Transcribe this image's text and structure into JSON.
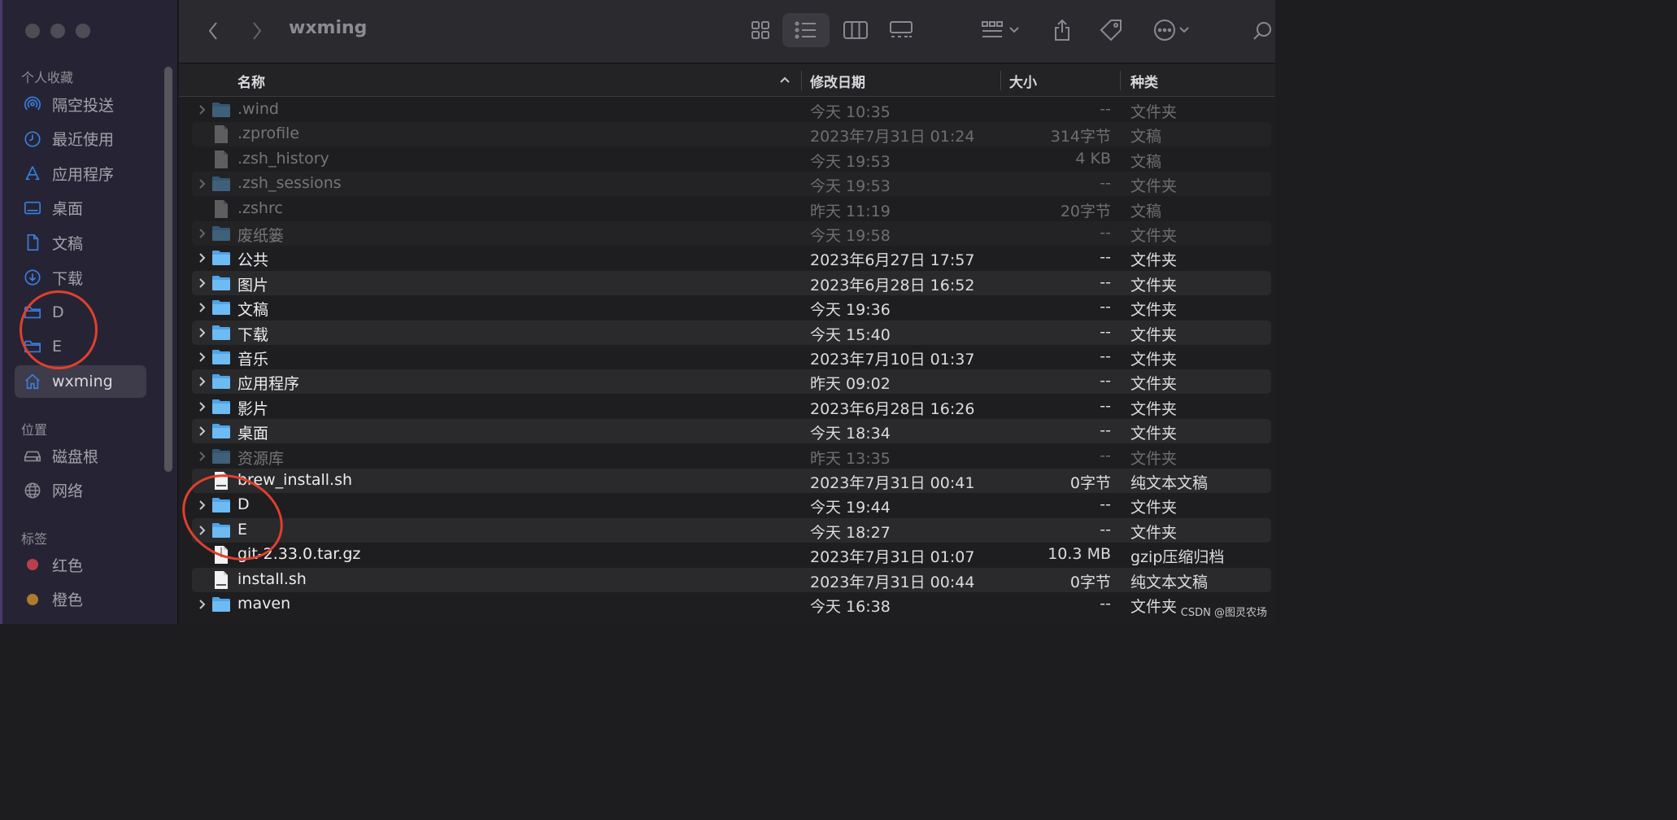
{
  "window": {
    "title": "wxming"
  },
  "sidebar": {
    "favorites_title": "个人收藏",
    "favorites": [
      {
        "label": "隔空投送",
        "icon": "airdrop-icon"
      },
      {
        "label": "最近使用",
        "icon": "clock-icon"
      },
      {
        "label": "应用程序",
        "icon": "applications-icon"
      },
      {
        "label": "桌面",
        "icon": "desktop-icon"
      },
      {
        "label": "文稿",
        "icon": "document-icon"
      },
      {
        "label": "下载",
        "icon": "download-icon"
      },
      {
        "label": "D",
        "icon": "folder-icon"
      },
      {
        "label": "E",
        "icon": "folder-icon"
      },
      {
        "label": "wxming",
        "icon": "home-icon",
        "active": true
      }
    ],
    "locations_title": "位置",
    "locations": [
      {
        "label": "磁盘根",
        "icon": "disk-icon"
      },
      {
        "label": "网络",
        "icon": "network-icon"
      }
    ],
    "tags_title": "标签",
    "tags": [
      {
        "label": "红色",
        "color": "#b8404a"
      },
      {
        "label": "橙色",
        "color": "#b07a2e"
      }
    ]
  },
  "table": {
    "columns": {
      "name": "名称",
      "date": "修改日期",
      "size": "大小",
      "kind": "种类"
    },
    "rows": [
      {
        "name": ".wind",
        "date": "今天 10:35",
        "size": "--",
        "kind": "文件夹",
        "type": "folder",
        "dim": true
      },
      {
        "name": ".zprofile",
        "date": "2023年7月31日 01:24",
        "size": "314字节",
        "kind": "文稿",
        "type": "doc",
        "dim": true
      },
      {
        "name": ".zsh_history",
        "date": "今天 19:53",
        "size": "4 KB",
        "kind": "文稿",
        "type": "doc",
        "dim": true
      },
      {
        "name": ".zsh_sessions",
        "date": "今天 19:53",
        "size": "--",
        "kind": "文件夹",
        "type": "folder",
        "dim": true
      },
      {
        "name": ".zshrc",
        "date": "昨天 11:19",
        "size": "20字节",
        "kind": "文稿",
        "type": "doc",
        "dim": true
      },
      {
        "name": "废纸篓",
        "date": "今天 19:58",
        "size": "--",
        "kind": "文件夹",
        "type": "folder",
        "dim": true
      },
      {
        "name": "公共",
        "date": "2023年6月27日 17:57",
        "size": "--",
        "kind": "文件夹",
        "type": "folder"
      },
      {
        "name": "图片",
        "date": "2023年6月28日 16:52",
        "size": "--",
        "kind": "文件夹",
        "type": "folder"
      },
      {
        "name": "文稿",
        "date": "今天 19:36",
        "size": "--",
        "kind": "文件夹",
        "type": "folder"
      },
      {
        "name": "下载",
        "date": "今天 15:40",
        "size": "--",
        "kind": "文件夹",
        "type": "folder"
      },
      {
        "name": "音乐",
        "date": "2023年7月10日 01:37",
        "size": "--",
        "kind": "文件夹",
        "type": "folder"
      },
      {
        "name": "应用程序",
        "date": "昨天 09:02",
        "size": "--",
        "kind": "文件夹",
        "type": "folder"
      },
      {
        "name": "影片",
        "date": "2023年6月28日 16:26",
        "size": "--",
        "kind": "文件夹",
        "type": "folder"
      },
      {
        "name": "桌面",
        "date": "今天 18:34",
        "size": "--",
        "kind": "文件夹",
        "type": "folder"
      },
      {
        "name": "资源库",
        "date": "昨天 13:35",
        "size": "--",
        "kind": "文件夹",
        "type": "folder",
        "dim": true
      },
      {
        "name": "brew_install.sh",
        "date": "2023年7月31日 00:41",
        "size": "0字节",
        "kind": "纯文本文稿",
        "type": "shell"
      },
      {
        "name": "D",
        "date": "今天 19:44",
        "size": "--",
        "kind": "文件夹",
        "type": "folder"
      },
      {
        "name": "E",
        "date": "今天 18:27",
        "size": "--",
        "kind": "文件夹",
        "type": "folder"
      },
      {
        "name": "git-2.33.0.tar.gz",
        "date": "2023年7月31日 01:07",
        "size": "10.3 MB",
        "kind": "gzip压缩归档",
        "type": "archive"
      },
      {
        "name": "install.sh",
        "date": "2023年7月31日 00:44",
        "size": "0字节",
        "kind": "纯文本文稿",
        "type": "shell"
      },
      {
        "name": "maven",
        "date": "今天 16:38",
        "size": "--",
        "kind": "文件夹",
        "type": "folder"
      }
    ]
  },
  "watermark": "CSDN @图灵农场"
}
